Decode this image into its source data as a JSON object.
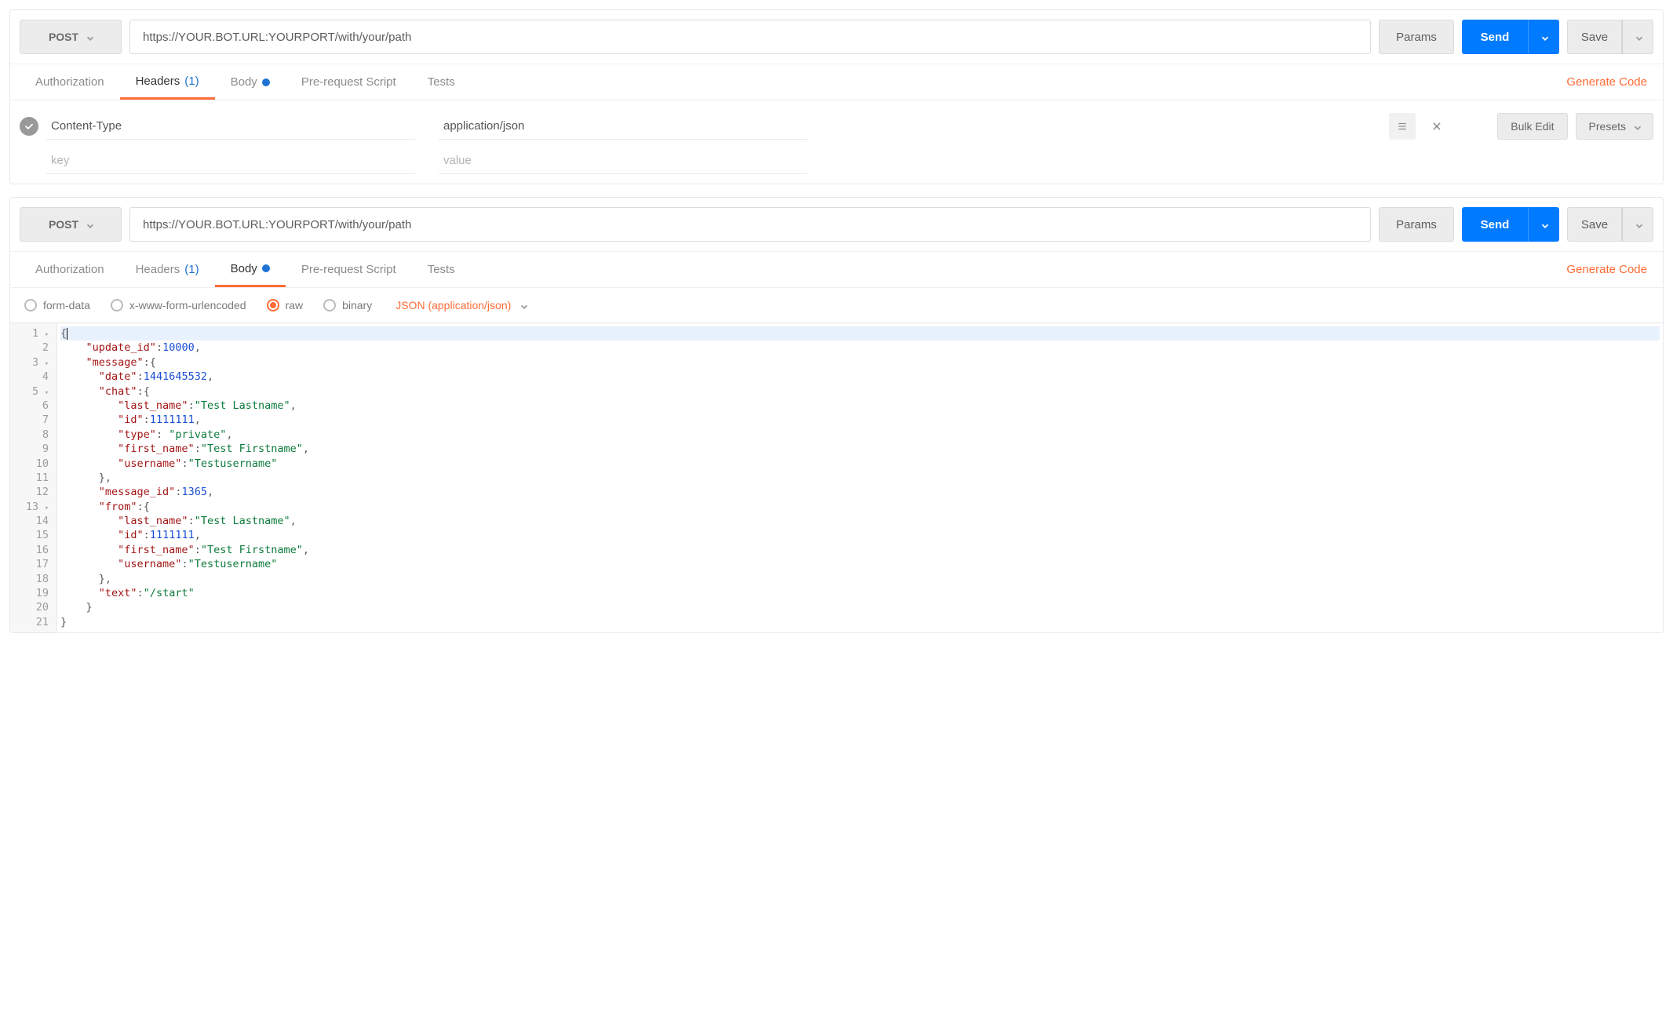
{
  "request_top": {
    "method": "POST",
    "url": "https://YOUR.BOT.URL:YOURPORT/with/your/path",
    "params_label": "Params",
    "send_label": "Send",
    "save_label": "Save",
    "tabs": {
      "authorization": "Authorization",
      "headers": "Headers",
      "headers_count": "(1)",
      "body": "Body",
      "prescript": "Pre-request Script",
      "tests": "Tests"
    },
    "generate_code": "Generate Code",
    "headers_section": {
      "key1": "Content-Type",
      "value1": "application/json",
      "key_placeholder": "key",
      "value_placeholder": "value",
      "bulk_edit": "Bulk Edit",
      "presets": "Presets"
    }
  },
  "request_bottom": {
    "method": "POST",
    "url": "https://YOUR.BOT.URL:YOURPORT/with/your/path",
    "params_label": "Params",
    "send_label": "Send",
    "save_label": "Save",
    "tabs": {
      "authorization": "Authorization",
      "headers": "Headers",
      "headers_count": "(1)",
      "body": "Body",
      "prescript": "Pre-request Script",
      "tests": "Tests"
    },
    "generate_code": "Generate Code",
    "body_options": {
      "form_data": "form-data",
      "urlencoded": "x-www-form-urlencoded",
      "raw": "raw",
      "binary": "binary",
      "content_type": "JSON (application/json)"
    },
    "code_lines": [
      {
        "n": 1,
        "fold": true,
        "hl": true,
        "tokens": [
          {
            "t": "pun",
            "v": "{"
          }
        ]
      },
      {
        "n": 2,
        "tokens": [
          {
            "t": "ind",
            "v": "    "
          },
          {
            "t": "key",
            "v": "\"update_id\""
          },
          {
            "t": "pun",
            "v": ":"
          },
          {
            "t": "num",
            "v": "10000"
          },
          {
            "t": "pun",
            "v": ","
          }
        ]
      },
      {
        "n": 3,
        "fold": true,
        "tokens": [
          {
            "t": "ind",
            "v": "    "
          },
          {
            "t": "key",
            "v": "\"message\""
          },
          {
            "t": "pun",
            "v": ":{"
          }
        ]
      },
      {
        "n": 4,
        "tokens": [
          {
            "t": "ind",
            "v": "      "
          },
          {
            "t": "key",
            "v": "\"date\""
          },
          {
            "t": "pun",
            "v": ":"
          },
          {
            "t": "num",
            "v": "1441645532"
          },
          {
            "t": "pun",
            "v": ","
          }
        ]
      },
      {
        "n": 5,
        "fold": true,
        "tokens": [
          {
            "t": "ind",
            "v": "      "
          },
          {
            "t": "key",
            "v": "\"chat\""
          },
          {
            "t": "pun",
            "v": ":{"
          }
        ]
      },
      {
        "n": 6,
        "tokens": [
          {
            "t": "ind",
            "v": "         "
          },
          {
            "t": "key",
            "v": "\"last_name\""
          },
          {
            "t": "pun",
            "v": ":"
          },
          {
            "t": "str",
            "v": "\"Test Lastname\""
          },
          {
            "t": "pun",
            "v": ","
          }
        ]
      },
      {
        "n": 7,
        "tokens": [
          {
            "t": "ind",
            "v": "         "
          },
          {
            "t": "key",
            "v": "\"id\""
          },
          {
            "t": "pun",
            "v": ":"
          },
          {
            "t": "num",
            "v": "1111111"
          },
          {
            "t": "pun",
            "v": ","
          }
        ]
      },
      {
        "n": 8,
        "tokens": [
          {
            "t": "ind",
            "v": "         "
          },
          {
            "t": "key",
            "v": "\"type\""
          },
          {
            "t": "pun",
            "v": ": "
          },
          {
            "t": "str",
            "v": "\"private\""
          },
          {
            "t": "pun",
            "v": ","
          }
        ]
      },
      {
        "n": 9,
        "tokens": [
          {
            "t": "ind",
            "v": "         "
          },
          {
            "t": "key",
            "v": "\"first_name\""
          },
          {
            "t": "pun",
            "v": ":"
          },
          {
            "t": "str",
            "v": "\"Test Firstname\""
          },
          {
            "t": "pun",
            "v": ","
          }
        ]
      },
      {
        "n": 10,
        "tokens": [
          {
            "t": "ind",
            "v": "         "
          },
          {
            "t": "key",
            "v": "\"username\""
          },
          {
            "t": "pun",
            "v": ":"
          },
          {
            "t": "str",
            "v": "\"Testusername\""
          }
        ]
      },
      {
        "n": 11,
        "tokens": [
          {
            "t": "ind",
            "v": "      "
          },
          {
            "t": "pun",
            "v": "},"
          }
        ]
      },
      {
        "n": 12,
        "tokens": [
          {
            "t": "ind",
            "v": "      "
          },
          {
            "t": "key",
            "v": "\"message_id\""
          },
          {
            "t": "pun",
            "v": ":"
          },
          {
            "t": "num",
            "v": "1365"
          },
          {
            "t": "pun",
            "v": ","
          }
        ]
      },
      {
        "n": 13,
        "fold": true,
        "tokens": [
          {
            "t": "ind",
            "v": "      "
          },
          {
            "t": "key",
            "v": "\"from\""
          },
          {
            "t": "pun",
            "v": ":{"
          }
        ]
      },
      {
        "n": 14,
        "tokens": [
          {
            "t": "ind",
            "v": "         "
          },
          {
            "t": "key",
            "v": "\"last_name\""
          },
          {
            "t": "pun",
            "v": ":"
          },
          {
            "t": "str",
            "v": "\"Test Lastname\""
          },
          {
            "t": "pun",
            "v": ","
          }
        ]
      },
      {
        "n": 15,
        "tokens": [
          {
            "t": "ind",
            "v": "         "
          },
          {
            "t": "key",
            "v": "\"id\""
          },
          {
            "t": "pun",
            "v": ":"
          },
          {
            "t": "num",
            "v": "1111111"
          },
          {
            "t": "pun",
            "v": ","
          }
        ]
      },
      {
        "n": 16,
        "tokens": [
          {
            "t": "ind",
            "v": "         "
          },
          {
            "t": "key",
            "v": "\"first_name\""
          },
          {
            "t": "pun",
            "v": ":"
          },
          {
            "t": "str",
            "v": "\"Test Firstname\""
          },
          {
            "t": "pun",
            "v": ","
          }
        ]
      },
      {
        "n": 17,
        "tokens": [
          {
            "t": "ind",
            "v": "         "
          },
          {
            "t": "key",
            "v": "\"username\""
          },
          {
            "t": "pun",
            "v": ":"
          },
          {
            "t": "str",
            "v": "\"Testusername\""
          }
        ]
      },
      {
        "n": 18,
        "tokens": [
          {
            "t": "ind",
            "v": "      "
          },
          {
            "t": "pun",
            "v": "},"
          }
        ]
      },
      {
        "n": 19,
        "tokens": [
          {
            "t": "ind",
            "v": "      "
          },
          {
            "t": "key",
            "v": "\"text\""
          },
          {
            "t": "pun",
            "v": ":"
          },
          {
            "t": "str",
            "v": "\"/start\""
          }
        ]
      },
      {
        "n": 20,
        "tokens": [
          {
            "t": "ind",
            "v": "    "
          },
          {
            "t": "pun",
            "v": "}"
          }
        ]
      },
      {
        "n": 21,
        "tokens": [
          {
            "t": "pun",
            "v": "}"
          }
        ]
      }
    ]
  }
}
